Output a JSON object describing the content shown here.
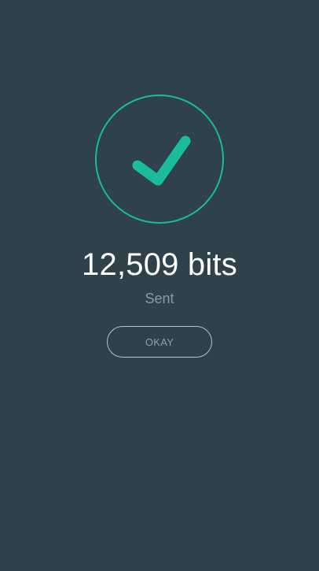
{
  "confirmation": {
    "amount": "12,509 bits",
    "status": "Sent",
    "button_label": "OKAY"
  },
  "colors": {
    "background": "#2f414b",
    "accent": "#1abc9c",
    "primary_text": "#ffffff",
    "secondary_text": "#8a9aa4",
    "button_border": "#b7c2c8"
  },
  "icons": {
    "success": "check-icon"
  }
}
